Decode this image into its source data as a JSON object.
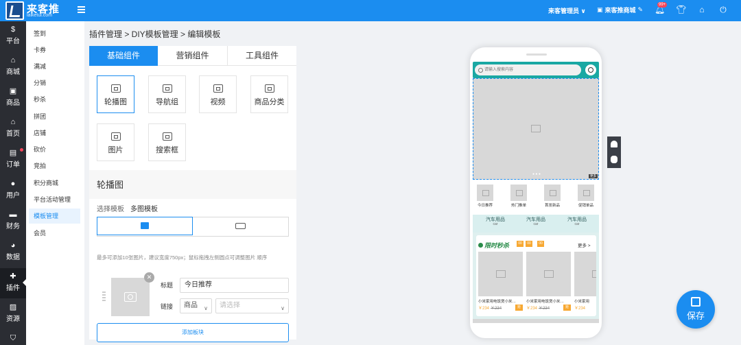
{
  "header": {
    "logo_text": "来客推",
    "logo_sub": "laiketui.com",
    "admin": "来客管理员 ∨",
    "store": "来客推商城",
    "badge": "99+"
  },
  "leftnav": [
    {
      "label": "平台",
      "icon": "dollar-icon"
    },
    {
      "label": "商城",
      "icon": "home-icon"
    },
    {
      "label": "商品",
      "icon": "bag-icon"
    },
    {
      "label": "首页",
      "icon": "home-icon"
    },
    {
      "label": "订单",
      "icon": "order-icon"
    },
    {
      "label": "用户",
      "icon": "user-icon"
    },
    {
      "label": "财务",
      "icon": "wallet-icon"
    },
    {
      "label": "数据",
      "icon": "pie-chart-icon"
    },
    {
      "label": "插件",
      "icon": "puzzle-icon"
    },
    {
      "label": "资源",
      "icon": "image-icon"
    }
  ],
  "subnav": [
    "签到",
    "卡券",
    "满减",
    "分销",
    "秒杀",
    "拼团",
    "店铺",
    "砍价",
    "竞拍",
    "积分商城",
    "平台活动管理",
    "模板管理",
    "会员"
  ],
  "breadcrumb": "插件管理 > DIY模板管理 > 编辑模板",
  "tabs": [
    "基础组件",
    "营销组件",
    "工具组件"
  ],
  "components": [
    "轮播图",
    "导航组",
    "视频",
    "商品分类",
    "图片",
    "搜索框"
  ],
  "editor": {
    "section_title": "轮播图",
    "template_label": "选择模板",
    "template_value": "多图模板",
    "tip": "最多可添加10张图片，建议宽度750px；鼠标拖拽左侧圆点可调整图片 顺序",
    "title_label": "标题",
    "title_value": "今日推荐",
    "link_label": "链接",
    "link_type": "商品",
    "link_placeholder": "请选择",
    "add_button": "添加板块"
  },
  "phone": {
    "search_placeholder": "请输入搜索内容",
    "banner_tag": "更多",
    "nav_items": [
      "今日推荐",
      "热门推单",
      "首发新品",
      "促销单品"
    ],
    "categories": [
      {
        "name": "汽车用品",
        "sub": "car"
      },
      {
        "name": "汽车用品",
        "sub": "car"
      },
      {
        "name": "汽车用品",
        "sub": "car"
      }
    ],
    "seckill_title": "限时秒杀",
    "countdown": [
      "00",
      "00",
      "00"
    ],
    "more": "更多 >",
    "products": [
      {
        "name": "小米家用电饭煲小米…",
        "price": "￥234",
        "old_price": "￥234",
        "btn": "抢"
      },
      {
        "name": "小米家用电饭煲小米…",
        "price": "￥234",
        "old_price": "￥234",
        "btn": "抢"
      },
      {
        "name": "小米家用",
        "price": "￥234",
        "old_price": "",
        "btn": ""
      }
    ]
  },
  "save_button": "保存"
}
